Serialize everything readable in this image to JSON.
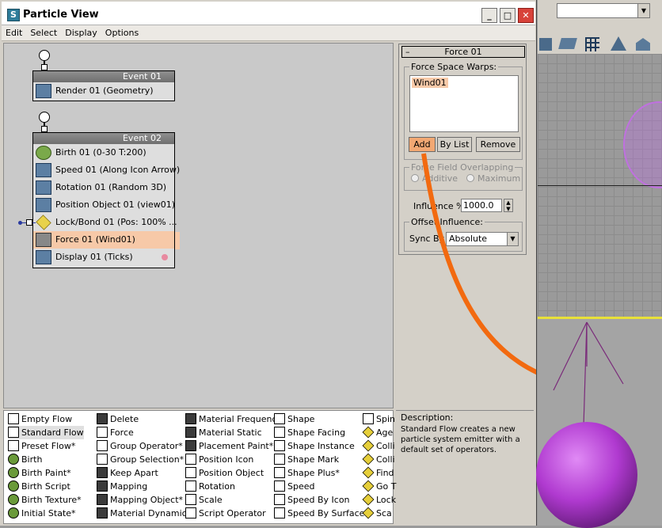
{
  "window": {
    "title": "Particle View"
  },
  "menu": [
    "Edit",
    "Select",
    "Display",
    "Options"
  ],
  "events": [
    {
      "header": "Event 01",
      "operators": [
        "Render 01 (Geometry)"
      ]
    },
    {
      "header": "Event 02",
      "operators": [
        "Birth 01 (0-30 T:200)",
        "Speed 01 (Along Icon Arrow)",
        "Rotation 01 (Random 3D)",
        "Position Object 01 (view01)",
        "Lock/Bond 01 (Pos: 100% ...",
        "Force 01 (Wind01)",
        "Display 01 (Ticks)"
      ]
    }
  ],
  "rollout": {
    "title": "Force 01",
    "collapse_glyph": "–",
    "force_space_warps_label": "Force Space Warps:",
    "force_list": [
      "Wind01"
    ],
    "add_label": "Add",
    "by_list_label": "By List",
    "remove_label": "Remove",
    "overlap_label": "Force Field Overlapping",
    "additive_label": "Additive",
    "maximum_label": "Maximum",
    "influence_label": "Influence %",
    "influence_value": "1000.0",
    "offset_label": "Offset Influence:",
    "sync_label": "Sync By",
    "sync_value": "Absolute"
  },
  "description": {
    "label": "Description:",
    "text": "Standard Flow creates a new particle system emitter with a default set of operators."
  },
  "depot": {
    "col1": [
      "Empty Flow",
      "Standard Flow",
      "Preset Flow*",
      "Birth",
      "Birth Paint*",
      "Birth Script",
      "Birth Texture*",
      "Initial State*"
    ],
    "col2": [
      "Delete",
      "Force",
      "Group Operator*",
      "Group Selection*",
      "Keep Apart",
      "Mapping",
      "Mapping Object*",
      "Material Dynamic"
    ],
    "col3": [
      "Material Frequency",
      "Material Static",
      "Placement Paint*",
      "Position Icon",
      "Position Object",
      "Rotation",
      "Scale",
      "Script Operator"
    ],
    "col4": [
      "Shape",
      "Shape Facing",
      "Shape Instance",
      "Shape Mark",
      "Shape Plus*",
      "Speed",
      "Speed By Icon",
      "Speed By Surface"
    ],
    "col5": [
      "Spin",
      "Age",
      "Colli",
      "Colli",
      "Find",
      "Go T",
      "Lock",
      "Sca"
    ]
  },
  "colors": {
    "selected": "#f7c9a8",
    "highlight": "#f2a873",
    "arrow": "#f26a10",
    "sphere": "#b03ad0"
  }
}
